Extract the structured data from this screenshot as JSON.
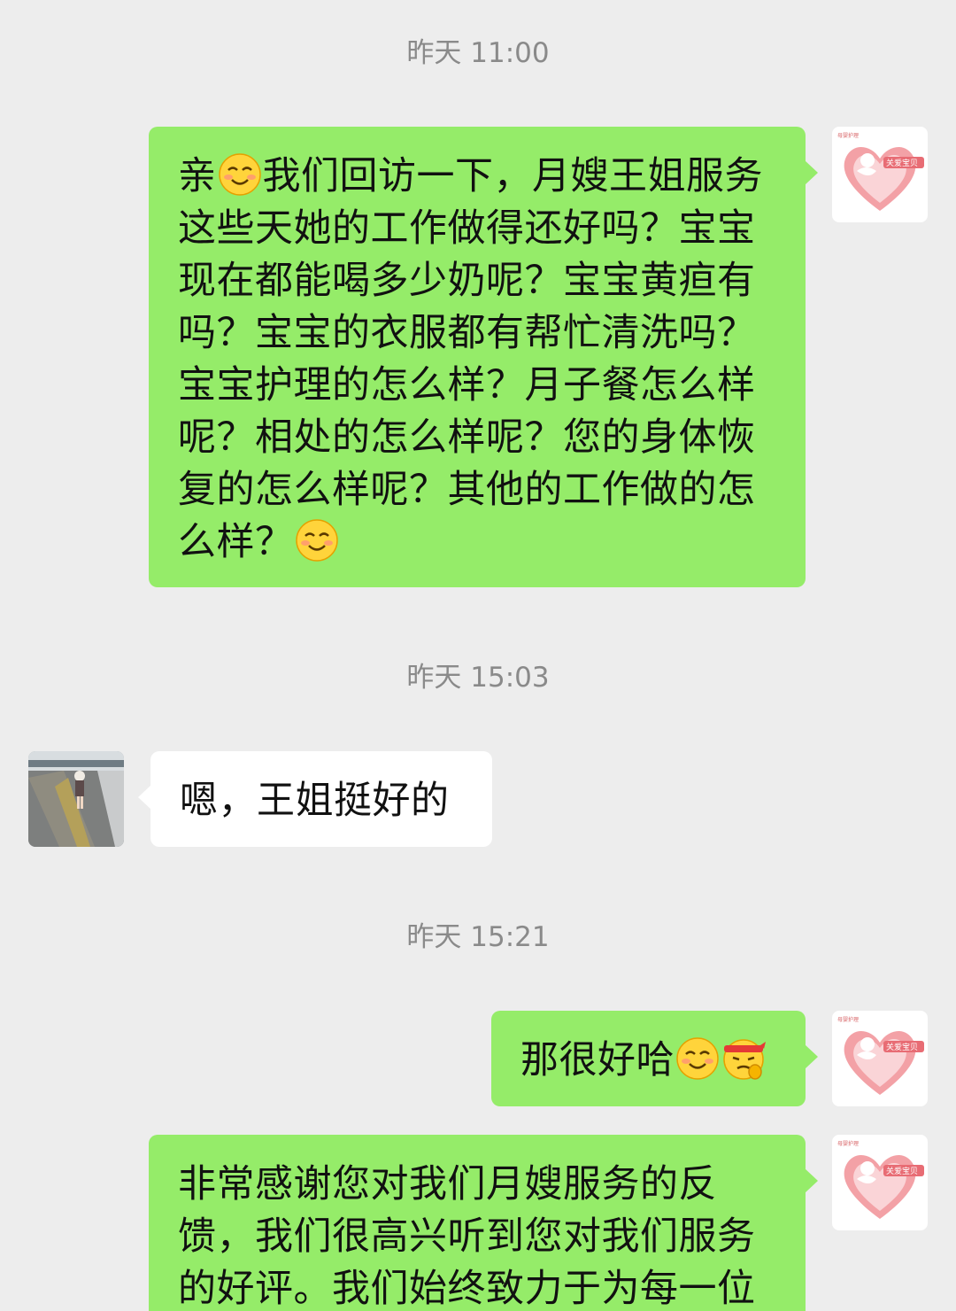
{
  "messages": [
    {
      "type": "time",
      "text": "昨天 11:00"
    },
    {
      "type": "outgoing",
      "avatar_icon": "heart-angel-logo-icon",
      "parts": [
        "亲",
        "smile-emoji",
        "我们回访一下，月嫂王姐服务这些天她的工作做得还好吗？宝宝现在都能喝多少奶呢？宝宝黄疸有吗？宝宝的衣服都有帮忙清洗吗？宝宝护理的怎么样？月子餐怎么样呢？相处的怎么样呢？您的身体恢复的怎么样呢？其他的工作做的怎么样？",
        "smile-emoji"
      ]
    },
    {
      "type": "time",
      "text": "昨天 15:03"
    },
    {
      "type": "incoming",
      "avatar_icon": "child-photo-avatar",
      "text": "嗯，王姐挺好的"
    },
    {
      "type": "time",
      "text": "昨天 15:21"
    },
    {
      "type": "outgoing",
      "avatar_icon": "heart-angel-logo-icon",
      "parts": [
        "那很好哈",
        "smile-emoji",
        "fighting-emoji"
      ]
    },
    {
      "type": "outgoing",
      "avatar_icon": "heart-angel-logo-icon",
      "text": "非常感谢您对我们月嫂服务的反馈，我们很高兴听到您对我们服务的好评。我们始终致力于为每一位"
    }
  ],
  "colors": {
    "background": "#ededed",
    "outgoing_bubble": "#95ec69",
    "incoming_bubble": "#ffffff",
    "timestamp_text": "#8a8a8a"
  }
}
